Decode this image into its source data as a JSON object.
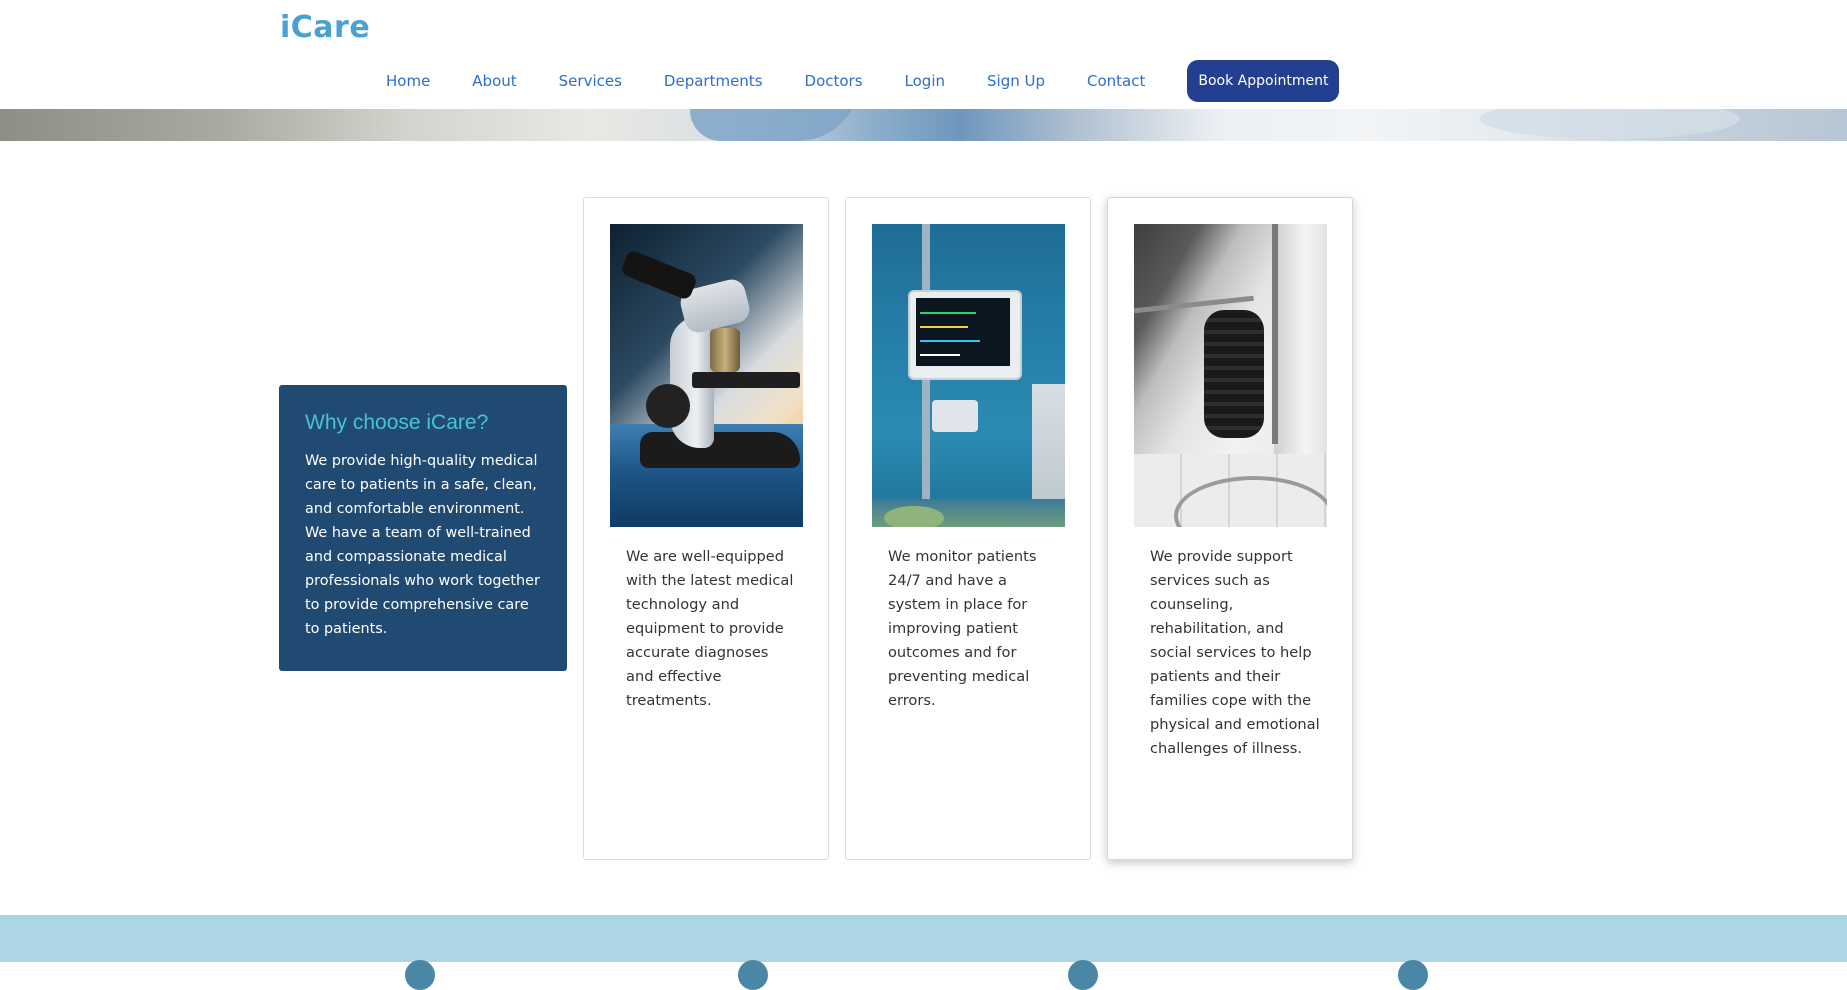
{
  "header": {
    "brand": "iCare",
    "nav": [
      "Home",
      "About",
      "Services",
      "Departments",
      "Doctors",
      "Login",
      "Sign Up",
      "Contact"
    ],
    "cta": "Book Appointment"
  },
  "why": {
    "title": "Why choose iCare?",
    "text": "We provide high-quality medical care to patients in a safe, clean, and comfortable environment. We have a team of well-trained and compassionate medical professionals who work together to provide comprehensive care to patients."
  },
  "cards": [
    {
      "image": "microscope-image",
      "text": "We are well-equipped with the latest medical technology and equipment to provide accurate diagnoses and effective treatments."
    },
    {
      "image": "patient-monitor-image",
      "text": "We monitor patients 24/7 and have a system in place for improving patient outcomes and for preventing medical errors."
    },
    {
      "image": "grab-bar-image",
      "text": "We provide support services such as counseling, rehabilitation, and social services to help patients and their families cope with the physical and emotional challenges of illness."
    }
  ],
  "colors": {
    "brand": "#4aa0d5",
    "nav_link": "#2e6fc7",
    "cta_bg": "#233f8f",
    "why_bg": "#214a73",
    "why_title": "#46c3d5",
    "bottom_band": "#acd6e3"
  }
}
